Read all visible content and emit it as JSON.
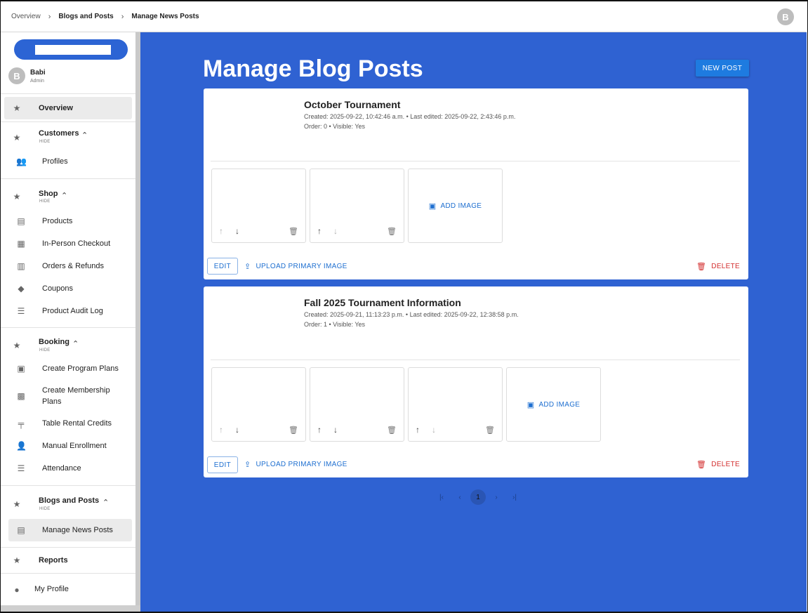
{
  "breadcrumb": [
    "Overview",
    "Blogs and Posts",
    "Manage News Posts"
  ],
  "top_avatar": "B",
  "sidebar": {
    "search_placeholder": "",
    "user": {
      "initial": "B",
      "name": "Babi",
      "role": "Admin"
    },
    "overview": "Overview",
    "hide_label": "HIDE",
    "sections": {
      "customers": {
        "title": "Customers",
        "items": [
          "Profiles"
        ]
      },
      "shop": {
        "title": "Shop",
        "items": [
          "Products",
          "In-Person Checkout",
          "Orders & Refunds",
          "Coupons",
          "Product Audit Log"
        ]
      },
      "booking": {
        "title": "Booking",
        "items": [
          "Create Program Plans",
          "Create Membership Plans",
          "Table Rental Credits",
          "Manual Enrollment",
          "Attendance"
        ]
      },
      "blogs": {
        "title": "Blogs and Posts",
        "items": [
          "Manage News Posts"
        ]
      }
    },
    "reports": "Reports",
    "my_profile": "My Profile"
  },
  "main": {
    "title": "Manage Blog Posts",
    "new_post": "NEW POST",
    "add_image": "ADD IMAGE",
    "edit": "EDIT",
    "upload_primary": "UPLOAD PRIMARY IMAGE",
    "delete": "DELETE",
    "posts": [
      {
        "title": "October Tournament",
        "created": "Created: 2025-09-22, 10:42:46 a.m. • Last edited: 2025-09-22, 2:43:46 p.m.",
        "order": "Order: 0 • Visible: Yes",
        "image_count": 2
      },
      {
        "title": "Fall 2025 Tournament Information",
        "created": "Created: 2025-09-21, 11:13:23 p.m. • Last edited: 2025-09-22, 12:38:58 p.m.",
        "order": "Order: 1 • Visible: Yes",
        "image_count": 3
      }
    ],
    "pagination": {
      "current": "1"
    }
  },
  "colors": {
    "main_bg": "#2f62d2",
    "accent": "#1e7be0",
    "danger": "#d32f2f"
  }
}
